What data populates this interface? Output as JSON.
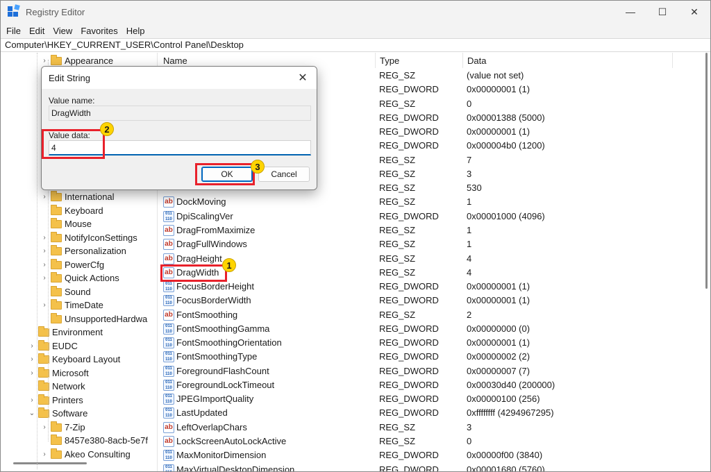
{
  "window": {
    "title": "Registry Editor",
    "controls": {
      "minimize": "—",
      "maximize": "☐",
      "close": "✕"
    }
  },
  "menu": [
    "File",
    "Edit",
    "View",
    "Favorites",
    "Help"
  ],
  "address": "Computer\\HKEY_CURRENT_USER\\Control Panel\\Desktop",
  "tree": [
    {
      "label": "Appearance",
      "expanded": false,
      "level": 2,
      "chevron": ">"
    },
    {
      "label": "International",
      "expanded": false,
      "level": 2,
      "chevron": ">"
    },
    {
      "label": "Keyboard",
      "level": 2,
      "chevron": ""
    },
    {
      "label": "Mouse",
      "level": 2,
      "chevron": ""
    },
    {
      "label": "NotifyIconSettings",
      "level": 2,
      "chevron": ">"
    },
    {
      "label": "Personalization",
      "level": 2,
      "chevron": ">"
    },
    {
      "label": "PowerCfg",
      "level": 2,
      "chevron": ">"
    },
    {
      "label": "Quick Actions",
      "level": 2,
      "chevron": ">"
    },
    {
      "label": "Sound",
      "level": 2,
      "chevron": ""
    },
    {
      "label": "TimeDate",
      "level": 2,
      "chevron": ">"
    },
    {
      "label": "UnsupportedHardwa",
      "level": 2,
      "chevron": ""
    },
    {
      "label": "Environment",
      "level": 1,
      "chevron": ""
    },
    {
      "label": "EUDC",
      "level": 1,
      "chevron": ">"
    },
    {
      "label": "Keyboard Layout",
      "level": 1,
      "chevron": ">"
    },
    {
      "label": "Microsoft",
      "level": 1,
      "chevron": ">"
    },
    {
      "label": "Network",
      "level": 1,
      "chevron": ""
    },
    {
      "label": "Printers",
      "level": 1,
      "chevron": ">"
    },
    {
      "label": "Software",
      "level": 1,
      "chevron": "v"
    },
    {
      "label": "7-Zip",
      "level": 2,
      "chevron": ">"
    },
    {
      "label": "8457e380-8acb-5e7f",
      "level": 2,
      "chevron": ""
    },
    {
      "label": "Akeo Consulting",
      "level": 2,
      "chevron": ">"
    }
  ],
  "columns": {
    "name": "Name",
    "type": "Type",
    "data": "Data"
  },
  "rows": [
    {
      "name": "",
      "type": "REG_SZ",
      "data": "(value not set)",
      "icon": "string"
    },
    {
      "name": "",
      "type": "REG_DWORD",
      "data": "0x00000001 (1)",
      "icon": "dword"
    },
    {
      "name": "",
      "type": "REG_SZ",
      "data": "0",
      "icon": "string"
    },
    {
      "name": "",
      "type": "REG_DWORD",
      "data": "0x00001388 (5000)",
      "icon": "dword"
    },
    {
      "name": "",
      "type": "REG_DWORD",
      "data": "0x00000001 (1)",
      "icon": "dword"
    },
    {
      "name": "",
      "type": "REG_DWORD",
      "data": "0x000004b0 (1200)",
      "icon": "dword"
    },
    {
      "name": "",
      "type": "REG_SZ",
      "data": "7",
      "icon": "string"
    },
    {
      "name": "",
      "type": "REG_SZ",
      "data": "3",
      "icon": "string"
    },
    {
      "name": "",
      "type": "REG_SZ",
      "data": "530",
      "icon": "string"
    },
    {
      "name": "DockMoving",
      "type": "REG_SZ",
      "data": "1",
      "icon": "string"
    },
    {
      "name": "DpiScalingVer",
      "type": "REG_DWORD",
      "data": "0x00001000 (4096)",
      "icon": "dword"
    },
    {
      "name": "DragFromMaximize",
      "type": "REG_SZ",
      "data": "1",
      "icon": "string"
    },
    {
      "name": "DragFullWindows",
      "type": "REG_SZ",
      "data": "1",
      "icon": "string"
    },
    {
      "name": "DragHeight",
      "type": "REG_SZ",
      "data": "4",
      "icon": "string"
    },
    {
      "name": "DragWidth",
      "type": "REG_SZ",
      "data": "4",
      "icon": "string"
    },
    {
      "name": "FocusBorderHeight",
      "type": "REG_DWORD",
      "data": "0x00000001 (1)",
      "icon": "dword"
    },
    {
      "name": "FocusBorderWidth",
      "type": "REG_DWORD",
      "data": "0x00000001 (1)",
      "icon": "dword"
    },
    {
      "name": "FontSmoothing",
      "type": "REG_SZ",
      "data": "2",
      "icon": "string"
    },
    {
      "name": "FontSmoothingGamma",
      "type": "REG_DWORD",
      "data": "0x00000000 (0)",
      "icon": "dword"
    },
    {
      "name": "FontSmoothingOrientation",
      "type": "REG_DWORD",
      "data": "0x00000001 (1)",
      "icon": "dword"
    },
    {
      "name": "FontSmoothingType",
      "type": "REG_DWORD",
      "data": "0x00000002 (2)",
      "icon": "dword"
    },
    {
      "name": "ForegroundFlashCount",
      "type": "REG_DWORD",
      "data": "0x00000007 (7)",
      "icon": "dword"
    },
    {
      "name": "ForegroundLockTimeout",
      "type": "REG_DWORD",
      "data": "0x00030d40 (200000)",
      "icon": "dword"
    },
    {
      "name": "JPEGImportQuality",
      "type": "REG_DWORD",
      "data": "0x00000100 (256)",
      "icon": "dword"
    },
    {
      "name": "LastUpdated",
      "type": "REG_DWORD",
      "data": "0xffffffff (4294967295)",
      "icon": "dword"
    },
    {
      "name": "LeftOverlapChars",
      "type": "REG_SZ",
      "data": "3",
      "icon": "string"
    },
    {
      "name": "LockScreenAutoLockActive",
      "type": "REG_SZ",
      "data": "0",
      "icon": "string"
    },
    {
      "name": "MaxMonitorDimension",
      "type": "REG_DWORD",
      "data": "0x00000f00 (3840)",
      "icon": "dword"
    },
    {
      "name": "MaxVirtualDesktopDimension",
      "type": "REG_DWORD",
      "data": "0x00001680 (5760)",
      "icon": "dword"
    }
  ],
  "dialog": {
    "title": "Edit String",
    "close": "✕",
    "value_name_label": "Value name:",
    "value_name": "DragWidth",
    "value_data_label": "Value data:",
    "value_data": "4",
    "ok": "OK",
    "cancel": "Cancel"
  },
  "annotations": {
    "badge_1": "1",
    "badge_2": "2",
    "badge_3": "3",
    "highlight_color": "#e8212b",
    "badge_color": "#ffd400"
  }
}
